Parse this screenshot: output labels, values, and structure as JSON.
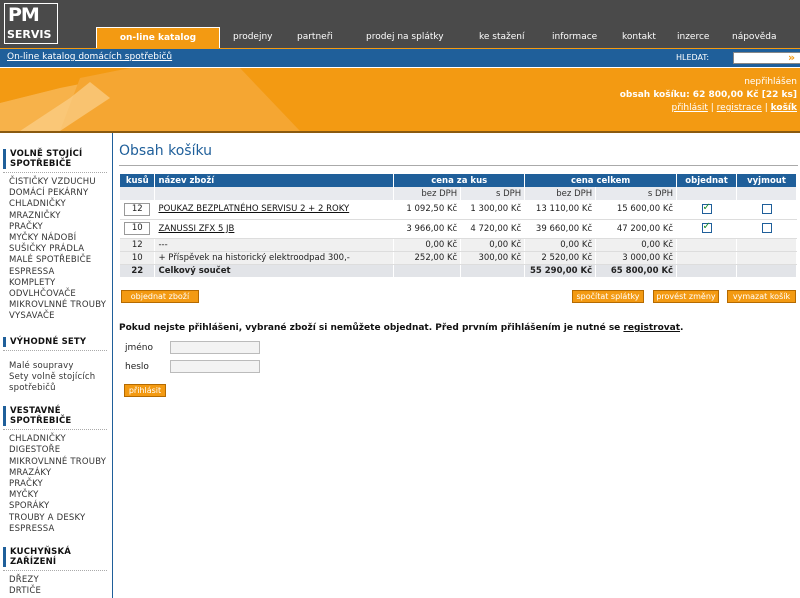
{
  "logo": {
    "line1": "PM",
    "line2": "SERVIS"
  },
  "nav": [
    {
      "label": "on-line katalog",
      "active": true
    },
    {
      "label": "prodejny"
    },
    {
      "label": "partneři"
    },
    {
      "label": "prodej na splátky"
    },
    {
      "label": "ke stažení"
    },
    {
      "label": "informace"
    },
    {
      "label": "kontakt"
    },
    {
      "label": "inzerce"
    },
    {
      "label": "nápověda"
    }
  ],
  "breadcrumb": "On-line katalog domácích spotřebičů",
  "search": {
    "label": "HLEDAT:",
    "value": "",
    "go_icon": "double-arrow-right-icon"
  },
  "user": {
    "status": "nepřihlášen",
    "cart_summary": "obsah košíku: 62 800,00 Kč [22 ks]",
    "links": [
      "přihlásit",
      "registrace",
      "košík"
    ],
    "separator": "|"
  },
  "sidebar": {
    "sections": [
      {
        "title": "VOLNĚ STOJÍCÍ SPOTŘEBIČE",
        "items": [
          "ČISTIČKY VZDUCHU",
          "DOMÁCÍ PEKÁRNY",
          "CHLADNIČKY",
          "MRAZNIČKY",
          "PRAČKY",
          "MYČKY NÁDOBÍ",
          "SUŠIČKY PRÁDLA",
          "MALÉ SPOTŘEBIČE",
          "ESPRESSA",
          "KOMPLETY",
          "ODVLHČOVAČE",
          "MIKROVLNNÉ TROUBY",
          "VYSAVAČE"
        ]
      },
      {
        "title": "VÝHODNÉ SETY",
        "items": [
          "Malé soupravy",
          "Sety volně stojících spotřebičů"
        ]
      },
      {
        "title": "VESTAVNÉ SPOTŘEBIČE",
        "items": [
          "CHLADNIČKY",
          "DIGESTOŘE",
          "MIKROVLNNÉ TROUBY",
          "MRAZÁKY",
          "PRAČKY",
          "MYČKY",
          "SPORÁKY",
          "TROUBY A DESKY",
          "ESPRESSA"
        ]
      },
      {
        "title": "KUCHYŇSKÁ ZAŘÍZENÍ",
        "items": [
          "DŘEZY",
          "DRTIČE"
        ]
      }
    ]
  },
  "main": {
    "title": "Obsah košíku",
    "table": {
      "headers": {
        "qty": "kusů",
        "name": "název zboží",
        "unit_price": "cena za kus",
        "total_price": "cena celkem",
        "order": "objednat",
        "remove": "vyjmout"
      },
      "subheaders": {
        "no_vat": "bez DPH",
        "with_vat": "s DPH"
      },
      "rows": [
        {
          "qty": "12",
          "name": "POUKAZ BEZPLATNÉHO SERVISU 2 + 2 ROKY",
          "unit_no_vat": "1 092,50 Kč",
          "unit_vat": "1 300,00 Kč",
          "total_no_vat": "13 110,00 Kč",
          "total_vat": "15 600,00 Kč",
          "order": true,
          "remove": false
        },
        {
          "qty": "10",
          "name": "ZANUSSI ZFX 5 JB",
          "unit_no_vat": "3 966,00 Kč",
          "unit_vat": "4 720,00 Kč",
          "total_no_vat": "39 660,00 Kč",
          "total_vat": "47 200,00 Kč",
          "order": true,
          "remove": false
        },
        {
          "qty": "12",
          "name": "---",
          "unit_no_vat": "0,00 Kč",
          "unit_vat": "0,00 Kč",
          "total_no_vat": "0,00 Kč",
          "total_vat": "0,00 Kč"
        },
        {
          "qty": "10",
          "name": "+ Příspěvek na historický elektroodpad 300,-",
          "unit_no_vat": "252,00 Kč",
          "unit_vat": "300,00 Kč",
          "total_no_vat": "2 520,00 Kč",
          "total_vat": "3 000,00 Kč"
        }
      ],
      "total": {
        "qty": "22",
        "label": "Celkový součet",
        "total_no_vat": "55 290,00 Kč",
        "total_vat": "65 800,00 Kč"
      }
    },
    "buttons": {
      "order": "objednat zboží",
      "installments": "spočítat splátky",
      "apply": "provést změny",
      "clear": "vymazat košík"
    },
    "login": {
      "message": "Pokud nejste přihlášeni, vybrané zboží si nemůžete objednat. Před prvním přihlášením je nutné se",
      "register_link": "registrovat",
      "message_end": ".",
      "name_label": "jméno",
      "password_label": "heslo",
      "name_value": "",
      "password_value": "",
      "submit": "přihlásit"
    }
  },
  "colors": {
    "orange": "#f39a12",
    "blue": "#1f5f9a",
    "dark": "#4a4a4a"
  }
}
